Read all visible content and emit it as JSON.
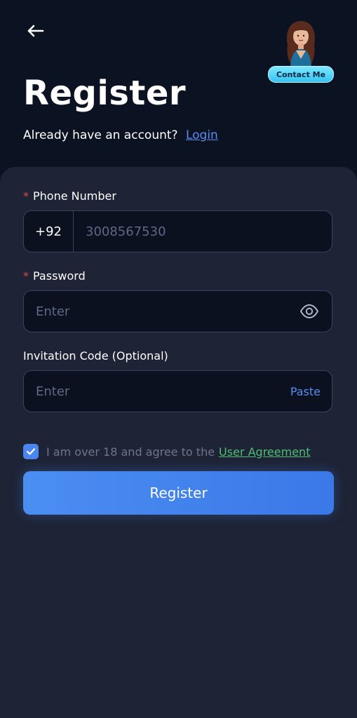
{
  "header": {
    "back_icon": "arrow-left-icon",
    "title": "Register",
    "subtitle": "Already have an account?",
    "login_link": "Login",
    "contact_button": "Contact Me",
    "avatar_icon": "support-agent-avatar"
  },
  "form": {
    "phone": {
      "label": "Phone Number",
      "required_mark": "*",
      "country_code": "+92",
      "placeholder": "3008567530"
    },
    "password": {
      "label": "Password",
      "required_mark": "*",
      "placeholder": "Enter",
      "toggle_icon": "eye-icon"
    },
    "invitation": {
      "label": "Invitation Code (Optional)",
      "placeholder": "Enter",
      "paste_label": "Paste"
    },
    "agreement": {
      "checked": true,
      "text": "I am over 18 and agree to the",
      "link": "User Agreement"
    },
    "submit_label": "Register"
  },
  "colors": {
    "background": "#0b1222",
    "card": "#1e2335",
    "accent": "#4a86ee",
    "link_green": "#4fbf73",
    "required_red": "#e04a4a"
  }
}
